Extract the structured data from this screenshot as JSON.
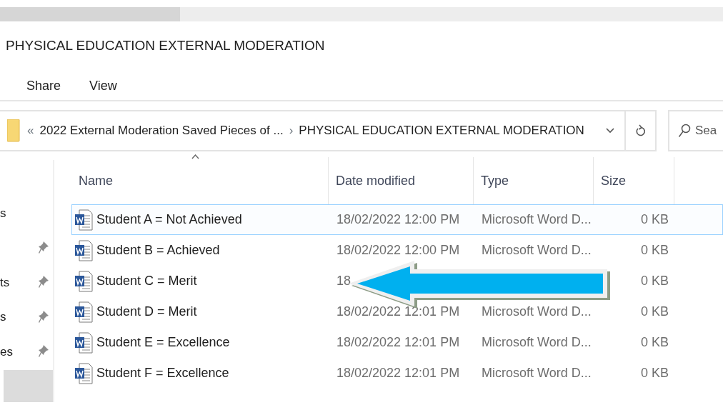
{
  "window": {
    "title": "PHYSICAL EDUCATION EXTERNAL MODERATION"
  },
  "ribbon_tabs": [
    {
      "label": "Share"
    },
    {
      "label": "View"
    }
  ],
  "address_bar": {
    "overflow": "«",
    "segments": [
      {
        "label": "2022 External Moderation Saved Pieces of ..."
      },
      {
        "label": "PHYSICAL EDUCATION EXTERNAL MODERATION"
      }
    ],
    "separator": "›"
  },
  "search": {
    "placeholder": "Sea"
  },
  "nav_pane": {
    "items": [
      {
        "label": "s",
        "pinned": false
      },
      {
        "pinned": true
      },
      {
        "label": "ts",
        "pinned": true
      },
      {
        "label": "s",
        "pinned": true
      },
      {
        "label": "es",
        "pinned": true
      }
    ]
  },
  "table": {
    "columns": [
      {
        "label": "Name",
        "sorted": true
      },
      {
        "label": "Date modified",
        "sorted": false
      },
      {
        "label": "Type",
        "sorted": false
      },
      {
        "label": "Size",
        "sorted": false
      }
    ],
    "rows": [
      {
        "name": "Student A = Not Achieved",
        "date": "18/02/2022 12:00 PM",
        "type": "Microsoft Word D...",
        "size": "0 KB",
        "selected": true
      },
      {
        "name": "Student B = Achieved",
        "date": "18/02/2022 12:00 PM",
        "type": "Microsoft Word D...",
        "size": "0 KB",
        "selected": false
      },
      {
        "name": "Student C = Merit",
        "date": "18",
        "size": "0 KB",
        "selected": false
      },
      {
        "name": "Student D = Merit",
        "date": "18/02/2022 12:01 PM",
        "type": "Microsoft Word D...",
        "size": "0 KB",
        "selected": false
      },
      {
        "name": "Student E = Excellence",
        "date": "18/02/2022 12:01 PM",
        "type": "Microsoft Word D...",
        "size": "0 KB",
        "selected": false
      },
      {
        "name": "Student F = Excellence",
        "date": "18/02/2022 12:01 PM",
        "type": "Microsoft Word D...",
        "size": "0 KB",
        "selected": false
      }
    ]
  }
}
